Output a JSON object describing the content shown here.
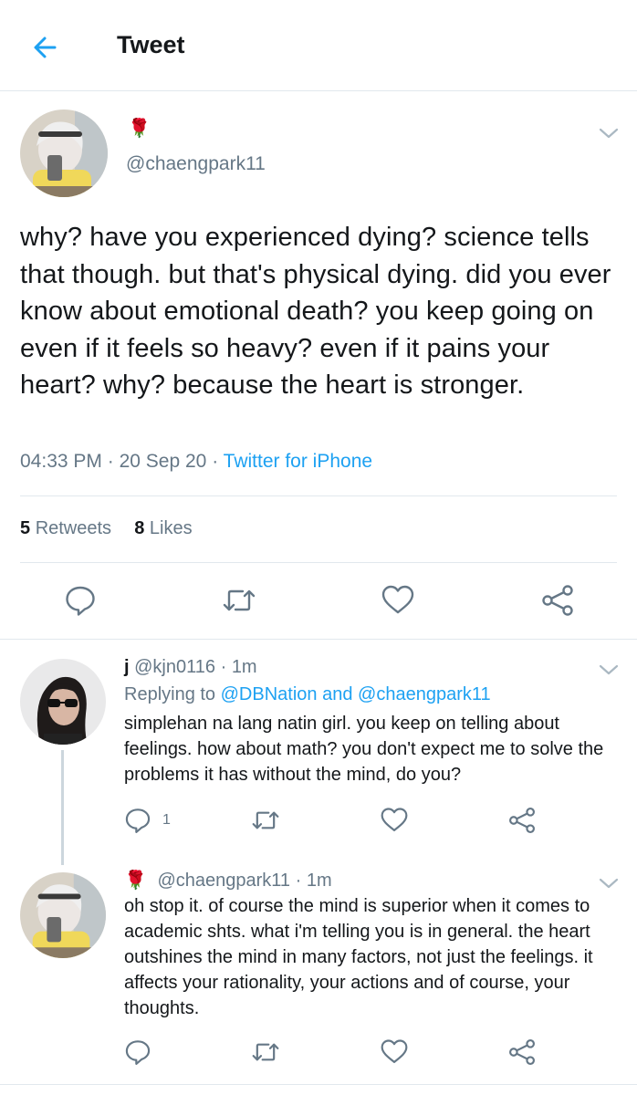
{
  "header": {
    "title": "Tweet"
  },
  "main_tweet": {
    "display_name_emoji": "🌹",
    "handle": "@chaengpark11",
    "text": "why? have you experienced dying? science tells that though. but that's physical dying. did you ever know about emotional death? you keep going on even if it feels so heavy? even if it pains your heart? why? because the heart is stronger.",
    "time": "04:33 PM",
    "date": "20 Sep 20",
    "source": "Twitter for iPhone",
    "retweets_count": "5",
    "retweets_label": "Retweets",
    "likes_count": "8",
    "likes_label": "Likes"
  },
  "replies": [
    {
      "name": "j",
      "handle": "@kjn0116",
      "age": "1m",
      "replying_prefix": "Replying to",
      "replying_to_1": "@DBNation",
      "replying_and": "and",
      "replying_to_2": "@chaengpark11",
      "text": "simplehan na lang natin girl. you keep on telling about feelings. how about math? you don't expect me to solve the problems it has without the mind, do you?",
      "reply_count": "1"
    },
    {
      "name": "🌹",
      "handle": "@chaengpark11",
      "age": "1m",
      "text": "oh stop it. of course the mind is superior when it comes to academic shts. what i'm telling you is in general. the heart outshines the mind in many factors, not just the feelings. it affects your rationality, your actions and of course, your thoughts."
    }
  ],
  "separator": "·",
  "colors": {
    "accent": "#1da1f2",
    "secondary_text": "#657786",
    "divider": "#e1e8ed",
    "icon": "#657786"
  },
  "icons": [
    "back-arrow-icon",
    "chevron-down-icon",
    "reply-icon",
    "retweet-icon",
    "like-icon",
    "share-icon"
  ]
}
